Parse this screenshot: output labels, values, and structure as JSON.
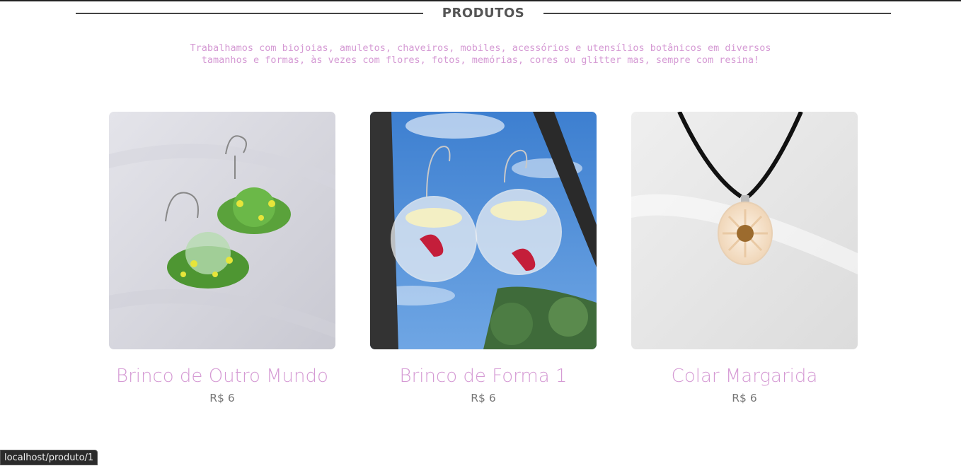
{
  "section": {
    "title": "PRODUTOS",
    "intro_line1": "Trabalhamos com biojoias, amuletos, chaveiros, mobiles, acessórios e utensílios botânicos em diversos",
    "intro_line2": "tamanhos e formas, às vezes com flores, fotos, memórias, cores ou glitter mas, sempre com resina!"
  },
  "products": [
    {
      "name": "Brinco de Outro Mundo",
      "price": "R$ 6"
    },
    {
      "name": "Brinco de Forma 1",
      "price": "R$ 6"
    },
    {
      "name": "Colar Margarida",
      "price": "R$ 6"
    }
  ],
  "status_bar": {
    "url": "localhost/produto/1"
  },
  "colors": {
    "accent_pink": "#d59ad4",
    "price_gray": "#777777",
    "header_gray": "#555555"
  }
}
